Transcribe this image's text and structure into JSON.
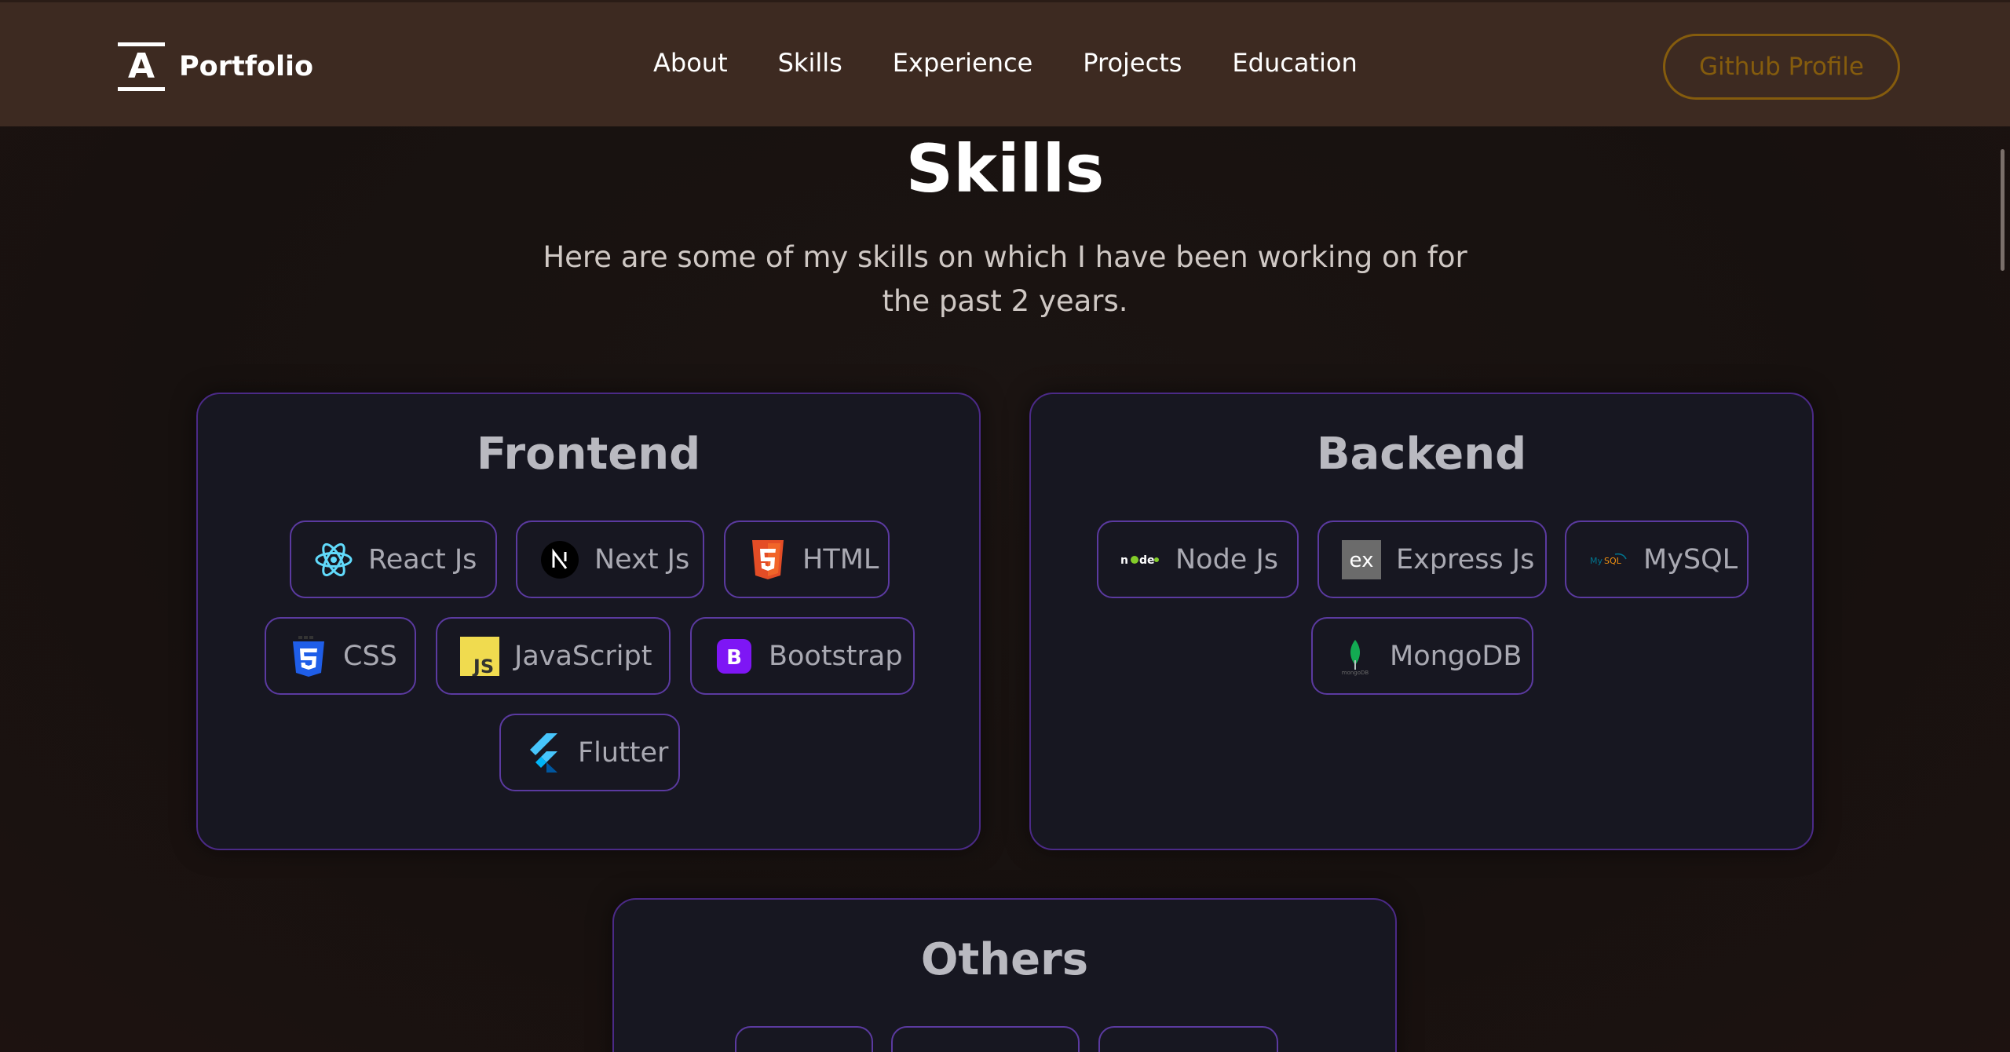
{
  "brand": {
    "mark_letter": "A",
    "name": "Portfolio"
  },
  "nav": {
    "items": [
      "About",
      "Skills",
      "Experience",
      "Projects",
      "Education"
    ]
  },
  "github_button": {
    "label": "Github Profile"
  },
  "section": {
    "title": "Skills",
    "description": "Here are some of my skills on which I have been working on for the past 2 years."
  },
  "cards": [
    {
      "title": "Frontend",
      "skills": [
        {
          "label": "React Js",
          "icon": "react-icon"
        },
        {
          "label": "Next Js",
          "icon": "nextjs-icon"
        },
        {
          "label": "HTML",
          "icon": "html5-icon"
        },
        {
          "label": "CSS",
          "icon": "css3-icon"
        },
        {
          "label": "JavaScript",
          "icon": "javascript-icon"
        },
        {
          "label": "Bootstrap",
          "icon": "bootstrap-icon"
        },
        {
          "label": "Flutter",
          "icon": "flutter-icon"
        }
      ]
    },
    {
      "title": "Backend",
      "skills": [
        {
          "label": "Node Js",
          "icon": "nodejs-icon"
        },
        {
          "label": "Express Js",
          "icon": "express-icon"
        },
        {
          "label": "MySQL",
          "icon": "mysql-icon"
        },
        {
          "label": "MongoDB",
          "icon": "mongodb-icon"
        }
      ]
    },
    {
      "title": "Others"
    }
  ],
  "colors": {
    "navbar_bg": "#3d2a21",
    "card_bg": "#171721",
    "card_border": "#4b2a87",
    "github_accent": "#855c0d"
  }
}
